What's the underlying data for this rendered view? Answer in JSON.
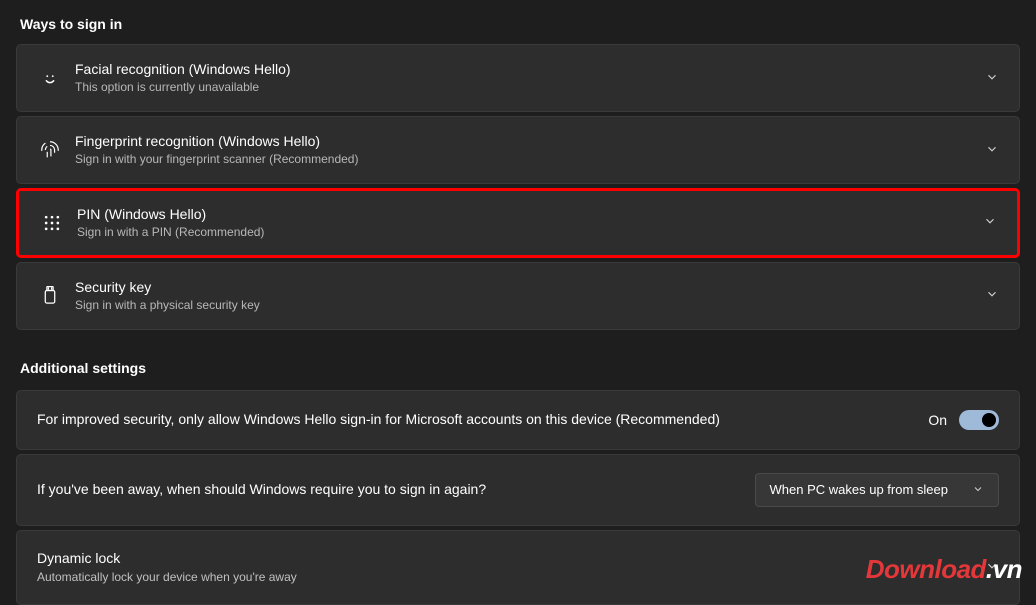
{
  "waysHeader": "Ways to sign in",
  "options": {
    "facial": {
      "title": "Facial recognition (Windows Hello)",
      "subtitle": "This option is currently unavailable"
    },
    "fingerprint": {
      "title": "Fingerprint recognition (Windows Hello)",
      "subtitle": "Sign in with your fingerprint scanner (Recommended)"
    },
    "pin": {
      "title": "PIN (Windows Hello)",
      "subtitle": "Sign in with a PIN (Recommended)"
    },
    "securityKey": {
      "title": "Security key",
      "subtitle": "Sign in with a physical security key"
    }
  },
  "additionalHeader": "Additional settings",
  "settings": {
    "helloOnly": {
      "label": "For improved security, only allow Windows Hello sign-in for Microsoft accounts on this device (Recommended)",
      "toggleState": "On"
    },
    "requireSignIn": {
      "label": "If you've been away, when should Windows require you to sign in again?",
      "selected": "When PC wakes up from sleep"
    },
    "dynamicLock": {
      "title": "Dynamic lock",
      "subtitle": "Automatically lock your device when you're away"
    }
  },
  "watermark": {
    "part1": "Download",
    "part2": ".vn"
  }
}
